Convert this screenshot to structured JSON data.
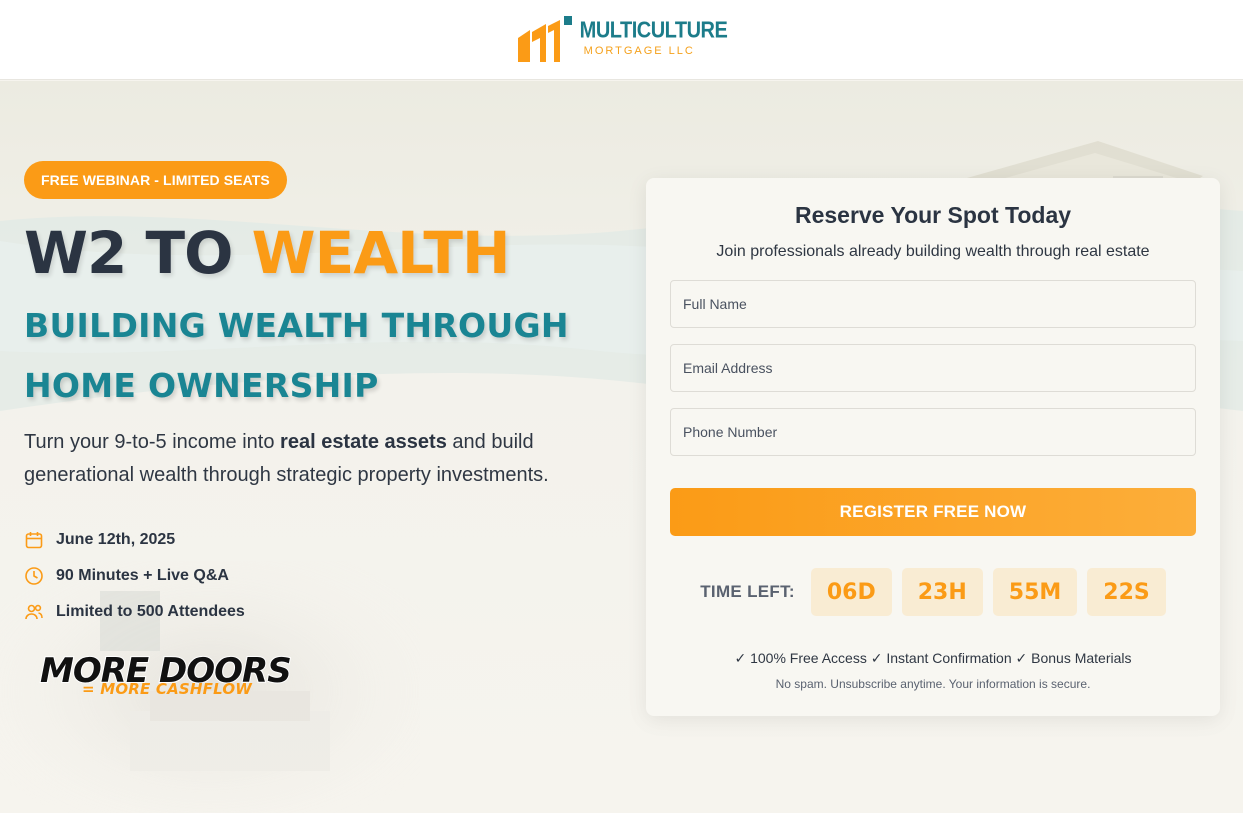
{
  "brand": {
    "name_line1": "MULTICULTURE",
    "name_line2": "MORTGAGE LLC",
    "colors": {
      "teal": "#1c7c8a",
      "orange": "#fb9b16",
      "dark": "#2b3442"
    }
  },
  "hero": {
    "badge": "FREE WEBINAR - LIMITED SEATS",
    "title_part1": "W2 TO ",
    "title_part2": "WEALTH",
    "subtitle_line1": "BUILDING WEALTH THROUGH",
    "subtitle_line2": "HOME OWNERSHIP",
    "lead_before": "Turn your 9-to-5 income into ",
    "lead_bold": "real estate assets",
    "lead_after": " and build generational wealth through strategic property investments.",
    "details": [
      {
        "icon": "calendar-icon",
        "text": "June 12th, 2025"
      },
      {
        "icon": "clock-icon",
        "text": "90 Minutes + Live Q&A"
      },
      {
        "icon": "users-icon",
        "text": "Limited to 500 Attendees"
      }
    ],
    "promo_line1": "MORE DOORS",
    "promo_line2": "= MORE CASHFLOW"
  },
  "form": {
    "title": "Reserve Your Spot Today",
    "subtitle": "Join professionals already building wealth through real estate",
    "full_name_placeholder": "Full Name",
    "email_placeholder": "Email Address",
    "phone_placeholder": "Phone Number",
    "submit_label": "REGISTER FREE NOW",
    "timer_label": "TIME LEFT:",
    "timer": {
      "days": "06D",
      "hours": "23H",
      "minutes": "55M",
      "seconds": "22S"
    },
    "perks": "✓ 100% Free Access ✓ Instant Confirmation ✓ Bonus Materials",
    "fine_print": "No spam. Unsubscribe anytime. Your information is secure."
  }
}
